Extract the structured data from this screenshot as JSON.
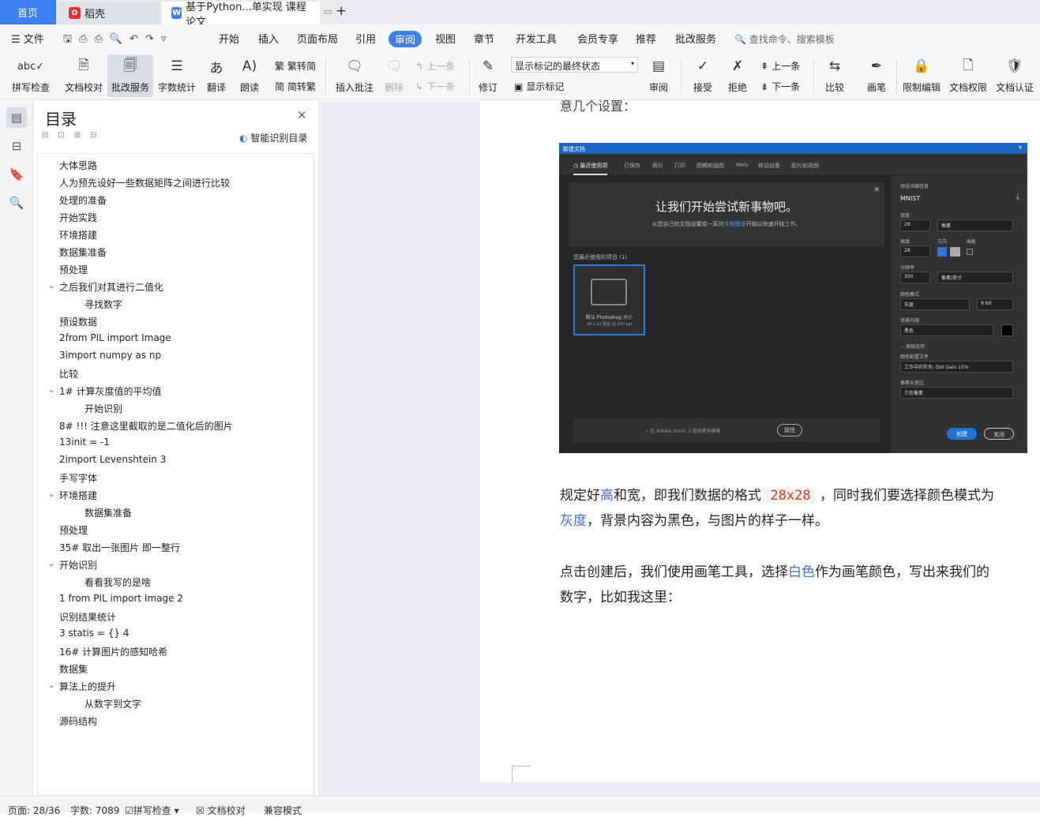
{
  "tabs": {
    "home": "首页",
    "daoke": "稻壳",
    "doc": "基于Python...单实现 课程论文"
  },
  "menubar": {
    "file": "文件",
    "items": [
      "开始",
      "插入",
      "页面布局",
      "引用",
      "审阅",
      "视图",
      "章节",
      "开发工具",
      "会员专享",
      "推荐",
      "批改服务"
    ],
    "search_placeholder": "查找命令、搜索模板"
  },
  "ribbon": {
    "spellcheck": "拼写检查",
    "doccheck": "文档校对",
    "review_service": "批改服务",
    "wordcount": "字数统计",
    "translate": "翻译",
    "read": "朗读",
    "to_trad": "繁转简",
    "to_simp": "简转繁",
    "insert_comment": "插入批注",
    "delete": "删除",
    "prev": "上一条",
    "next": "下一条",
    "revise": "修订",
    "markup_state": "显示标记的最终状态",
    "show_markup": "显示标记",
    "review": "审阅",
    "accept": "接受",
    "reject": "拒绝",
    "prev2": "上一条",
    "next2": "下一条",
    "compare": "比较",
    "pen": "画笔",
    "restrict": "限制编辑",
    "permission": "文档权限",
    "certify": "文档认证"
  },
  "toc": {
    "title": "目录",
    "smart": "智能识别目录",
    "items": [
      "大体思路",
      "人为预先设好一些数据矩阵之间进行比较",
      "处理的准备",
      "开始实践",
      "环境搭建",
      "数据集准备",
      "预处理",
      "之后我们对其进行二值化",
      "寻找数字",
      "预设数据",
      "2from  PIL  import  Image",
      "3import  numpy  as  np",
      "比较",
      "1# 计算灰度值的平均值",
      "开始识别",
      "8# !!! 注意这里截取的是二值化后的图片",
      "13init  =  -1",
      "2import  Levenshtein 3",
      "手写字体",
      "环境搭建",
      "数据集准备",
      "预处理",
      "35# 取出一张图片 即一整行",
      "开始识别",
      "看看我写的是啥",
      "1 from  PIL  import  Image 2",
      "识别结果统计",
      "3 statis = {} 4",
      "16# 计算图片的感知哈希",
      "数据集",
      "算法上的提升",
      "从数字到文字",
      "源码结构"
    ]
  },
  "doc": {
    "top_cut": "意几个设置：",
    "p1_a": "规定好",
    "p1_b": "高",
    "p1_c": "和宽，即我们数据的格式 ",
    "p1_code": "28x28",
    "p1_d": " ，同时我们要选择颜色模式为",
    "p1_e": "灰度",
    "p1_f": "，背景内容为黑色，与图片的样子一样。",
    "p2_a": "点击创建后，我们使用画笔工具，选择",
    "p2_b": "白色",
    "p2_c": "作为画笔颜色，写出来我们的",
    "p2_d": "数字，比如我这里："
  },
  "screenshot": {
    "window_title": "新建文档",
    "tabs": [
      "最近使用项",
      "已保存",
      "照片",
      "打印",
      "图稿和插图",
      "Web",
      "移动设备",
      "胶片和视频"
    ],
    "banner_title": "让我们开始尝试新事物吧。",
    "banner_sub_a": "从您自己的文档设置或一系列",
    "banner_sub_link": "文档预设",
    "banner_sub_b": "开始以快速开始工作。",
    "recent_label": "您最近使用的项目 (1)",
    "card_line1": "默认 Photoshop 大小",
    "card_line2": "16 x 12 厘米 @ 300 ppi",
    "stock_search": "在 Adobe Stock 上查找更多模板",
    "go": "前往",
    "side_section": "预设详细信息",
    "name": "MNIST",
    "width_label": "宽度",
    "width": "28",
    "unit": "像素",
    "height_label": "高度",
    "height": "28",
    "orient_label": "方向",
    "artboard_label": "画板",
    "res_label": "分辨率",
    "res": "300",
    "res_unit": "像素/英寸",
    "mode_label": "颜色模式",
    "mode": "灰度",
    "bit": "8 bit",
    "bg_label": "背景内容",
    "bg": "黑色",
    "advanced": "高级选项",
    "profile_label": "颜色配置文件",
    "profile": "工作中的灰色: Dot Gain 15%",
    "aspect_label": "像素长宽比",
    "aspect": "方形像素",
    "create": "创建",
    "close": "关闭"
  },
  "status": {
    "page": "页面: 28/36",
    "words": "字数: 7089",
    "spell": "拼写检查",
    "doccheck": "文档校对",
    "compat": "兼容模式"
  }
}
